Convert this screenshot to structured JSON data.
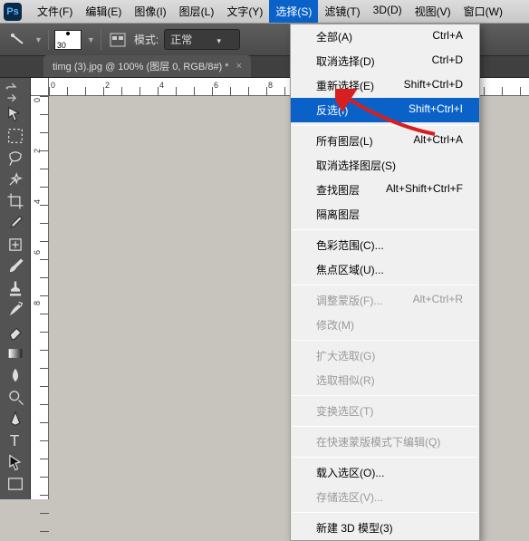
{
  "menubar": {
    "items": [
      "文件(F)",
      "编辑(E)",
      "图像(I)",
      "图层(L)",
      "文字(Y)",
      "选择(S)",
      "滤镜(T)",
      "3D(D)",
      "视图(V)",
      "窗口(W)"
    ],
    "open_index": 5
  },
  "toolbar": {
    "mode_label": "模式:",
    "mode_value": "正常",
    "swatch_value": "30"
  },
  "tab": {
    "title": "timg (3).jpg @ 100% (图层 0, RGB/8#) *",
    "close": "×"
  },
  "ruler": {
    "h_ticks": [
      "0",
      "2",
      "4",
      "6",
      "8"
    ],
    "v_ticks": [
      "0",
      "2",
      "4",
      "6",
      "8"
    ]
  },
  "dropdown": {
    "groups": [
      [
        {
          "label": "全部(A)",
          "shortcut": "Ctrl+A",
          "disabled": false
        },
        {
          "label": "取消选择(D)",
          "shortcut": "Ctrl+D",
          "disabled": false
        },
        {
          "label": "重新选择(E)",
          "shortcut": "Shift+Ctrl+D",
          "disabled": false
        },
        {
          "label": "反选(I)",
          "shortcut": "Shift+Ctrl+I",
          "disabled": false,
          "highlight": true
        }
      ],
      [
        {
          "label": "所有图层(L)",
          "shortcut": "Alt+Ctrl+A",
          "disabled": false
        },
        {
          "label": "取消选择图层(S)",
          "shortcut": "",
          "disabled": false
        },
        {
          "label": "查找图层",
          "shortcut": "Alt+Shift+Ctrl+F",
          "disabled": false
        },
        {
          "label": "隔离图层",
          "shortcut": "",
          "disabled": false
        }
      ],
      [
        {
          "label": "色彩范围(C)...",
          "shortcut": "",
          "disabled": false
        },
        {
          "label": "焦点区域(U)...",
          "shortcut": "",
          "disabled": false
        }
      ],
      [
        {
          "label": "调整蒙版(F)...",
          "shortcut": "Alt+Ctrl+R",
          "disabled": true
        },
        {
          "label": "修改(M)",
          "shortcut": "",
          "disabled": true
        }
      ],
      [
        {
          "label": "扩大选取(G)",
          "shortcut": "",
          "disabled": true
        },
        {
          "label": "选取相似(R)",
          "shortcut": "",
          "disabled": true
        }
      ],
      [
        {
          "label": "变换选区(T)",
          "shortcut": "",
          "disabled": true
        }
      ],
      [
        {
          "label": "在快速蒙版模式下编辑(Q)",
          "shortcut": "",
          "disabled": true
        }
      ],
      [
        {
          "label": "载入选区(O)...",
          "shortcut": "",
          "disabled": false
        },
        {
          "label": "存储选区(V)...",
          "shortcut": "",
          "disabled": true
        }
      ],
      [
        {
          "label": "新建 3D 模型(3)",
          "shortcut": "",
          "disabled": false
        }
      ]
    ]
  }
}
